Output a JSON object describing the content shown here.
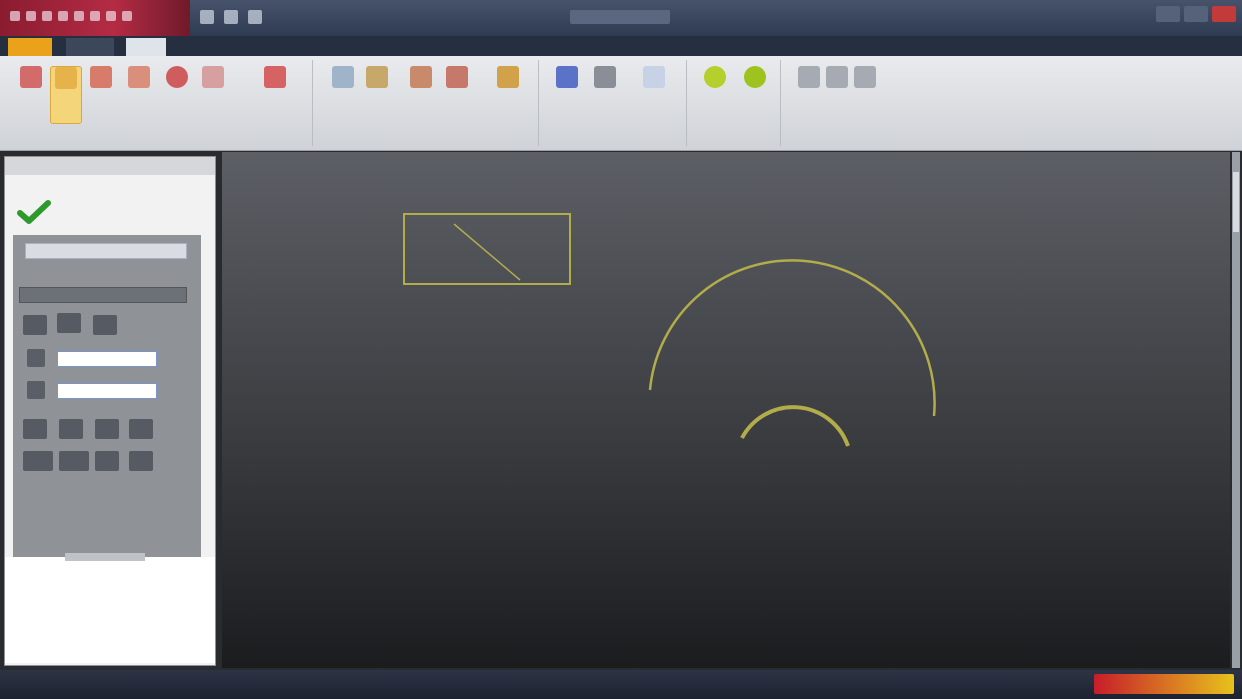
{
  "window": {
    "title": "",
    "controls": [
      "minimize",
      "maximize",
      "close"
    ]
  },
  "ribbon_tabs": [
    "",
    "",
    "",
    ""
  ],
  "ribbon": {
    "groups": [
      "",
      "",
      "",
      "",
      ""
    ],
    "tools_group1": [
      "",
      "",
      "",
      "",
      "",
      "",
      ""
    ],
    "tools_group2": [
      "",
      "",
      "",
      "",
      ""
    ],
    "tools_group3": [
      "",
      "",
      ""
    ],
    "tools_group4": [
      "",
      ""
    ],
    "tools_group5": [
      "",
      "",
      ""
    ]
  },
  "side_panel": {
    "header_title": "",
    "field1_value": "",
    "field2_value": ""
  },
  "status": {
    "subtitle": "",
    "logo_text": ""
  }
}
